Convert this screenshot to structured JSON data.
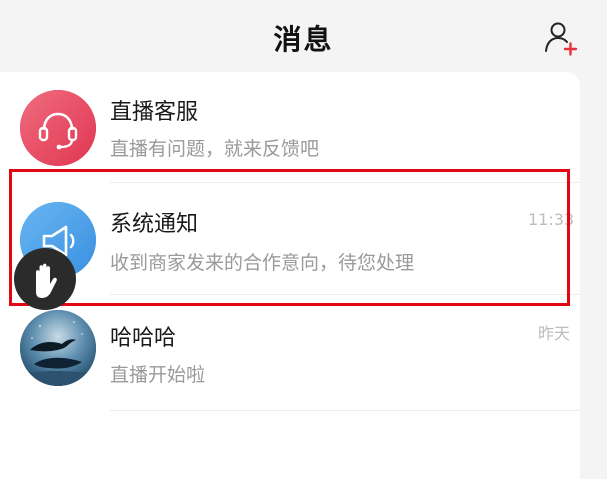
{
  "header": {
    "title": "消息",
    "add_icon": "add-contact-icon"
  },
  "messages": [
    {
      "title": "直播客服",
      "subtitle": "直播有问题，就来反馈吧",
      "time": "",
      "avatar_icon": "headset-icon",
      "avatar_color": "#e8455f"
    },
    {
      "title": "系统通知",
      "subtitle": "收到商家发来的合作意向，待您处理",
      "time": "11:33",
      "avatar_icon": "megaphone-icon",
      "avatar_color": "#4a9fe6"
    },
    {
      "title": "哈哈哈",
      "subtitle": "直播开始啦",
      "time": "昨天",
      "avatar_icon": "whale-photo",
      "avatar_color": "#1e4d6e"
    }
  ],
  "overlay": {
    "highlight_color": "#e30613",
    "hand_icon": "hand-icon"
  }
}
